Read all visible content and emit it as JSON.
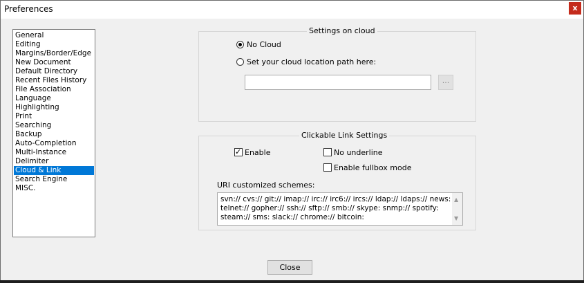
{
  "window": {
    "title": "Preferences",
    "close_glyph": "x"
  },
  "sidebar": {
    "items": [
      {
        "label": "General"
      },
      {
        "label": "Editing"
      },
      {
        "label": "Margins/Border/Edge"
      },
      {
        "label": "New Document"
      },
      {
        "label": "Default Directory"
      },
      {
        "label": "Recent Files History"
      },
      {
        "label": "File Association"
      },
      {
        "label": "Language"
      },
      {
        "label": "Highlighting"
      },
      {
        "label": "Print"
      },
      {
        "label": "Searching"
      },
      {
        "label": "Backup"
      },
      {
        "label": "Auto-Completion"
      },
      {
        "label": "Multi-Instance"
      },
      {
        "label": "Delimiter"
      },
      {
        "label": "Cloud & Link"
      },
      {
        "label": "Search Engine"
      },
      {
        "label": "MISC."
      }
    ],
    "selected": "Cloud & Link"
  },
  "cloud": {
    "group_label": "Settings on cloud",
    "no_cloud_label": "No Cloud",
    "no_cloud_selected": true,
    "custom_path_label": "Set your cloud location path here:",
    "custom_path_selected": false,
    "path_value": "",
    "browse_label": "..."
  },
  "link": {
    "group_label": "Clickable Link Settings",
    "enable_label": "Enable",
    "enable_checked": true,
    "no_underline_label": "No underline",
    "no_underline_checked": false,
    "fullbox_label": "Enable fullbox mode",
    "fullbox_checked": false,
    "uri_label": "URI customized schemes:",
    "uri_lines": [
      "svn:// cvs:// git:// imap:// irc:// irc6:// ircs:// ldap:// ldaps:// news:",
      "telnet:// gopher:// ssh:// sftp:// smb:// skype: snmp:// spotify:",
      "steam:// sms: slack:// chrome:// bitcoin:"
    ],
    "tick_glyph": "✓"
  },
  "footer": {
    "close_label": "Close"
  }
}
